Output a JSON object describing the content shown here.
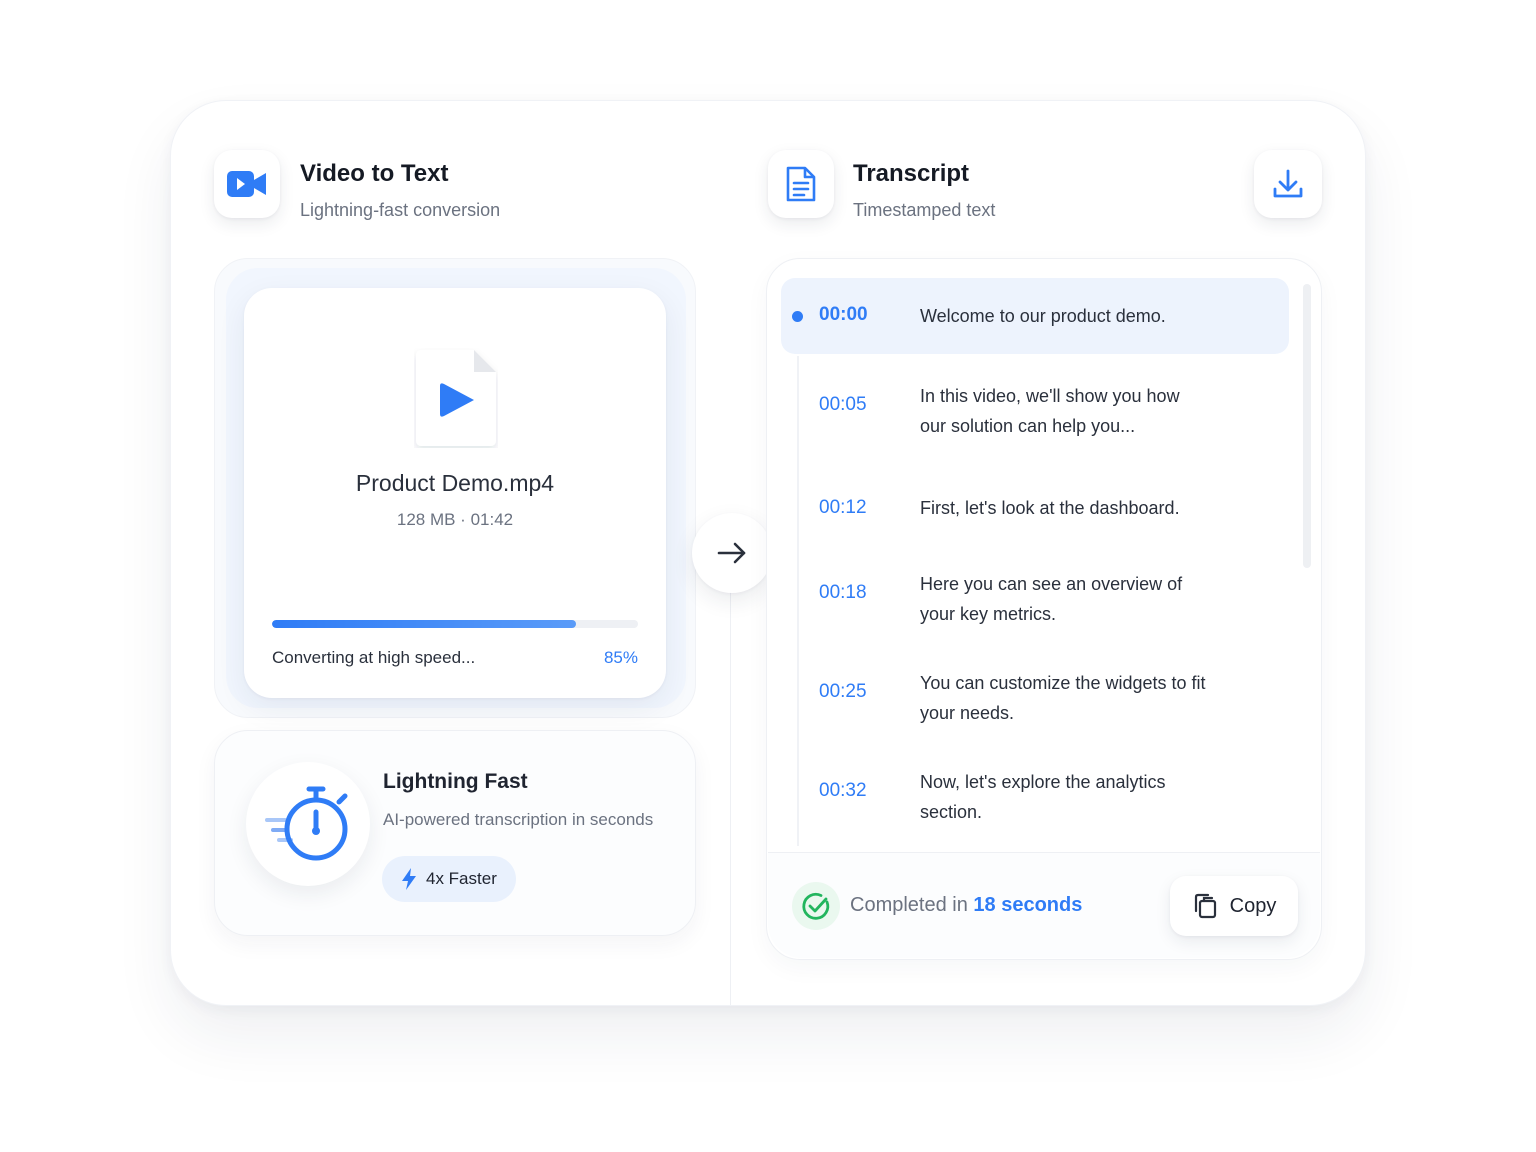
{
  "converter": {
    "title": "Video to Text",
    "subtitle": "Lightning-fast conversion",
    "icon": "video-camera-icon"
  },
  "transcript_header": {
    "title": "Transcript",
    "subtitle": "Timestamped text",
    "icon": "document-icon",
    "download_icon": "download-icon"
  },
  "file": {
    "name": "Product Demo.mp4",
    "meta": "128 MB · 01:42",
    "icon": "video-file-play-icon"
  },
  "progress": {
    "status": "Converting at high speed...",
    "percent_label": "85%",
    "fraction": 0.83
  },
  "speed": {
    "title": "Lightning Fast",
    "subtitle": "AI-powered transcription in seconds",
    "badge": "4x Faster",
    "icon": "stopwatch-icon",
    "badge_icon": "lightning-bolt-icon"
  },
  "transcript": {
    "rows": [
      {
        "time": "00:00",
        "text": "Welcome to our product demo.",
        "active": true
      },
      {
        "time": "00:05",
        "text": "In this video, we'll show you how our solution can help you...",
        "active": false
      },
      {
        "time": "00:12",
        "text": "First, let's look at the dashboard.",
        "active": false
      },
      {
        "time": "00:18",
        "text": "Here you can see an overview of your key metrics.",
        "active": false
      },
      {
        "time": "00:25",
        "text": "You can customize the widgets to fit your needs.",
        "active": false
      },
      {
        "time": "00:32",
        "text": "Now, let's explore the analytics section.",
        "active": false
      }
    ]
  },
  "status": {
    "prefix": "Completed in ",
    "duration": "18 seconds",
    "icon": "check-circle-icon"
  },
  "copy_button": {
    "label": "Copy",
    "icon": "copy-icon"
  },
  "colors": {
    "accent": "#2f7cf6",
    "success": "#22b55e",
    "text": "#1f2430",
    "muted": "#6b7280"
  }
}
